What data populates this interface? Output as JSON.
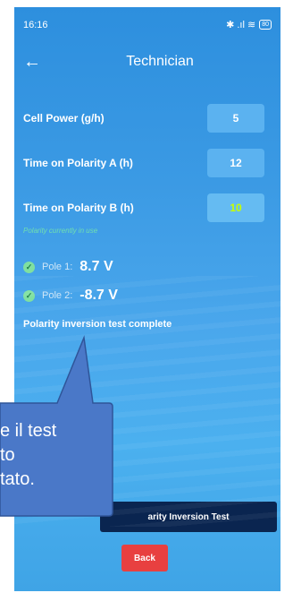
{
  "status_bar": {
    "time": "16:16",
    "icons": "✱ .ıl ≋",
    "battery": "80"
  },
  "app_bar": {
    "title": "Technician"
  },
  "settings": [
    {
      "label": "Cell Power (g/h)",
      "value": "5",
      "active": false
    },
    {
      "label": "Time on Polarity A (h)",
      "value": "12",
      "active": false
    },
    {
      "label": "Time on Polarity B (h)",
      "value": "10",
      "active": true
    }
  ],
  "polarity_hint": "Polarity currently in use",
  "poles": [
    {
      "label": "Pole 1:",
      "value": "8.7 V"
    },
    {
      "label": "Pole 2:",
      "value": "-8.7 V"
    }
  ],
  "status_message": "Polarity inversion test complete",
  "buttons": {
    "test": "arity Inversion Test",
    "back": "Back"
  },
  "callout": {
    "lines": [
      "e il test",
      "to",
      "tato."
    ]
  },
  "colors": {
    "background": "#3b9ae4",
    "field": "#5bb2f0",
    "active_value": "#c8ff00",
    "test_button": "#0a2550",
    "back_button": "#e84040",
    "callout": "#4a78c8"
  }
}
